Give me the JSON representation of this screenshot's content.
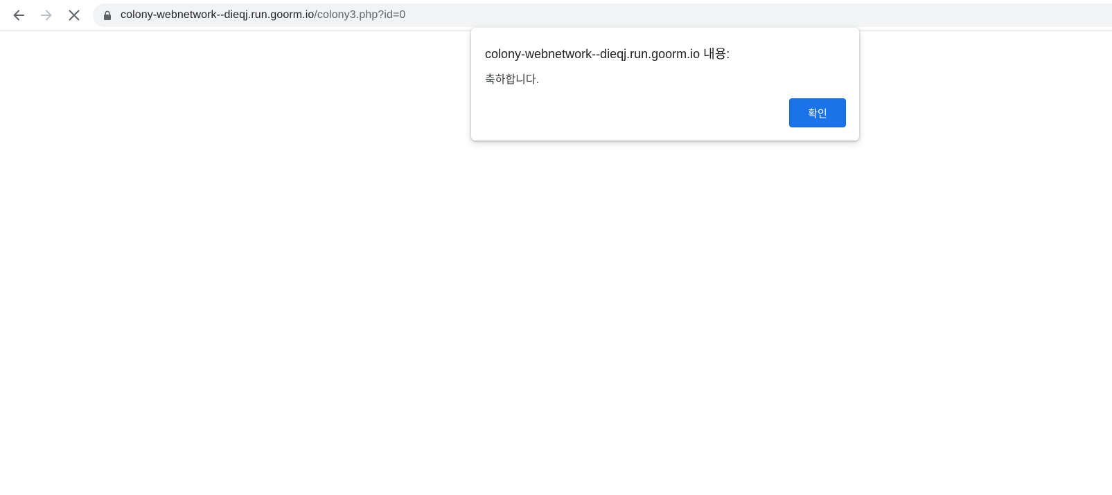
{
  "browser": {
    "icons": {
      "back": "arrow-left-icon",
      "forward": "arrow-right-icon",
      "stop": "close-icon",
      "lock": "lock-icon"
    },
    "address_bar": {
      "host": "colony-webnetwork--dieqj.run.goorm.io",
      "path": "/colony3.php?id=0"
    }
  },
  "alert_dialog": {
    "title": "colony-webnetwork--dieqj.run.goorm.io 내용:",
    "message": "축하합니다.",
    "ok_label": "확인"
  },
  "colors": {
    "accent": "#1a73e8",
    "omnibox_bg": "#f1f3f4",
    "text": "#202124",
    "muted": "#5f6368"
  }
}
